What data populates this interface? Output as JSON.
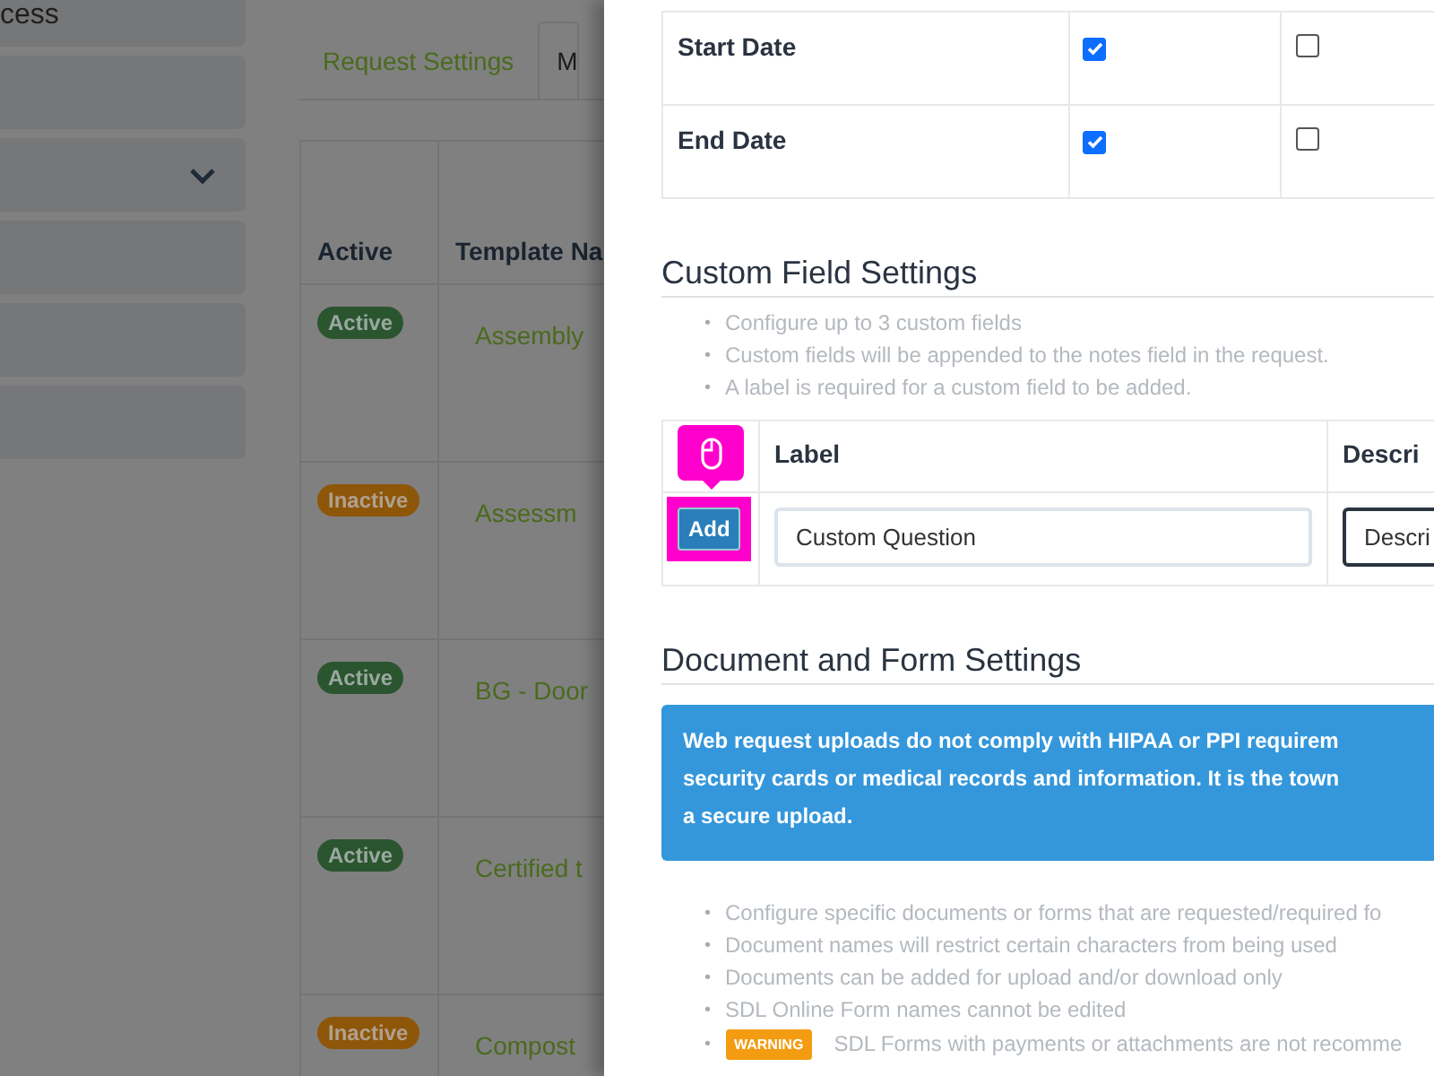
{
  "sidebar": {
    "items": [
      {
        "kind": "text",
        "label": "cess"
      },
      {
        "kind": "blank"
      },
      {
        "kind": "dropdown"
      },
      {
        "kind": "blank"
      },
      {
        "kind": "blank"
      },
      {
        "kind": "blank"
      }
    ]
  },
  "tabs": [
    {
      "label": "Request Settings",
      "selected": false
    },
    {
      "label": "M",
      "selected": true
    }
  ],
  "templates": {
    "columns": [
      "Active",
      "Template Na"
    ],
    "rows": [
      {
        "status": "Active",
        "active": true,
        "name": "Assembly"
      },
      {
        "status": "Inactive",
        "active": false,
        "name": "Assessm"
      },
      {
        "status": "Active",
        "active": true,
        "name": "BG - Door"
      },
      {
        "status": "Active",
        "active": true,
        "name": "Certified t"
      },
      {
        "status": "Inactive",
        "active": false,
        "name": "Compost"
      }
    ]
  },
  "drawer": {
    "field_table": {
      "rows": [
        {
          "name": "Start Date",
          "column_2": true,
          "column_3": false
        },
        {
          "name": "End Date",
          "column_2": true,
          "column_3": false
        }
      ]
    },
    "custom_fields": {
      "title": "Custom Field Settings",
      "bullet": "•",
      "notes": [
        "Configure up to 3 custom fields",
        "Custom fields will be appended to the notes field in the request.",
        "A label is required for a custom field to be added."
      ],
      "columns": [
        "Label",
        "Descri"
      ],
      "add_button": "Add",
      "highlighted": true,
      "label_value": "Custom Question",
      "description_placeholder": "Descri"
    },
    "documents": {
      "title": "Document and Form Settings",
      "alert_lines": [
        "Web request uploads do not comply with HIPAA or PPI requirem",
        "security cards or medical records and information. It is the town",
        "a secure upload."
      ],
      "bullet": "•",
      "notes": [
        {
          "text": "Configure specific documents or forms that are requested/required fo"
        },
        {
          "text": "Document names will restrict certain characters from being used"
        },
        {
          "text": "Documents can be added for upload and/or download only"
        },
        {
          "text": "SDL Online Form names cannot be edited"
        },
        {
          "badge": "WARNING",
          "text": "SDL Forms with payments or attachments are not recomme"
        }
      ]
    }
  }
}
